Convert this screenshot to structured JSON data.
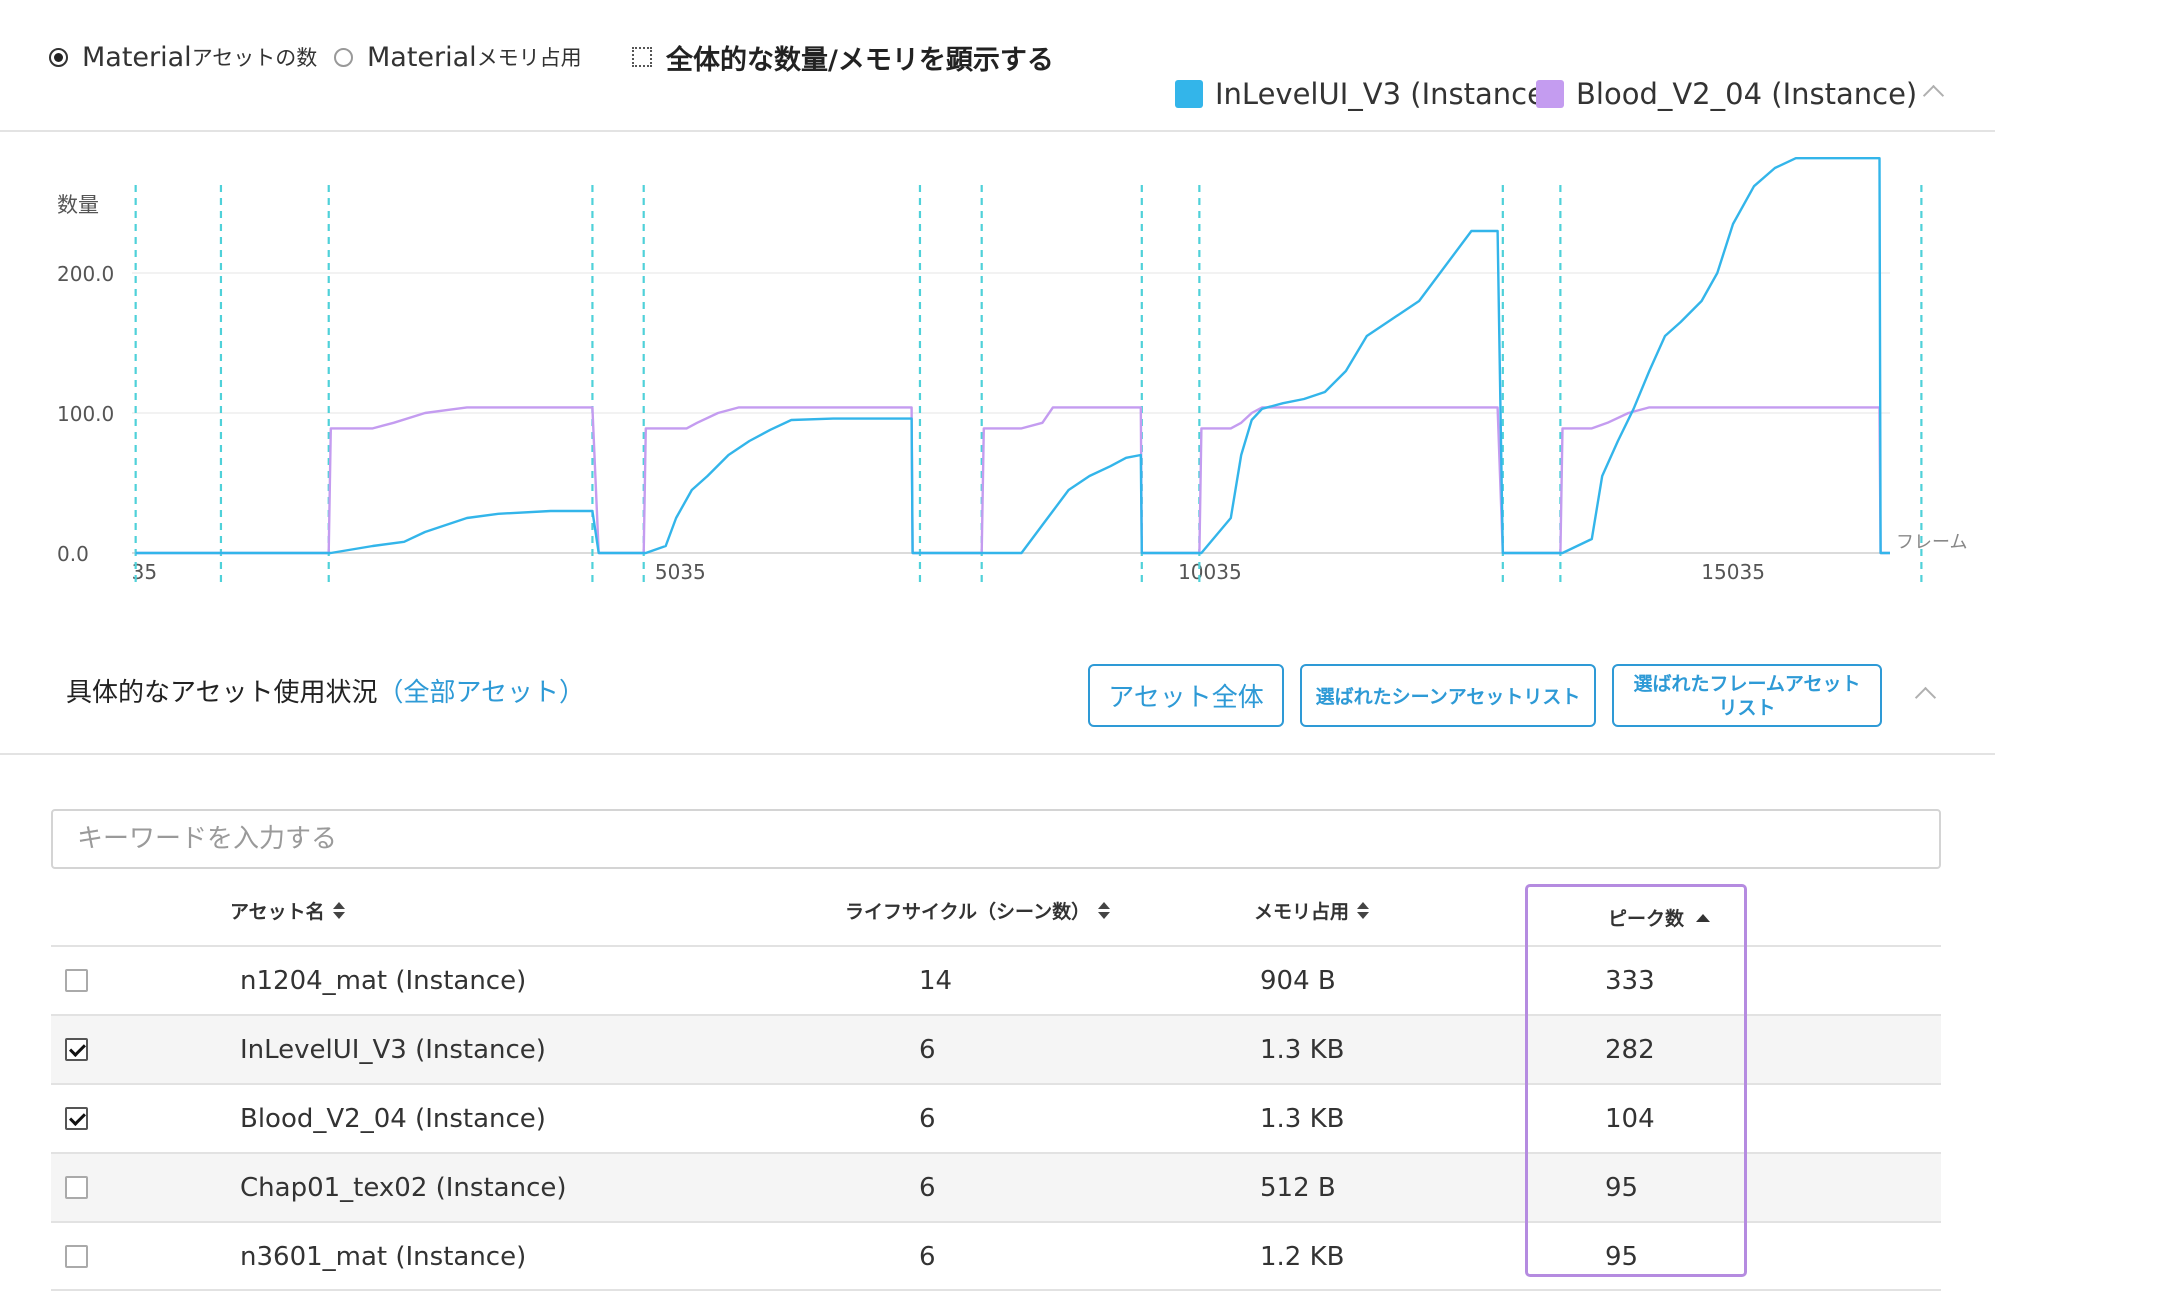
{
  "options": {
    "radio_count_main": "Material",
    "radio_count_sub": "アセットの数",
    "radio_memory_main": "Material",
    "radio_memory_sub": "メモリ占用",
    "show_total_label": "全体的な数量/メモリを顕示する",
    "selected": "count"
  },
  "legend": [
    {
      "label": "InLevelUI_V3 (Instance)",
      "color": "#33b5ea"
    },
    {
      "label": "Blood_V2_04 (Instance)",
      "color": "#c49cf0"
    }
  ],
  "icons": {
    "collapse": "chevron-up-icon",
    "sort": "sort-icon",
    "check": "checkbox-icon"
  },
  "chart_data": {
    "type": "line",
    "ylabel": "数量",
    "xlabel": "フレーム",
    "x_tick_labels": [
      "35",
      "5035",
      "10035",
      "15035"
    ],
    "y_tick_labels": [
      "0.0",
      "100.0",
      "200.0"
    ],
    "x_ticks": [
      35,
      5035,
      10035,
      15035
    ],
    "y_ticks": [
      0,
      100,
      200
    ],
    "xlim": [
      0,
      16800
    ],
    "ylim": [
      0,
      280
    ],
    "grid": "horizontal",
    "scene_markers": [
      35,
      850,
      1880,
      4400,
      4890,
      7530,
      8120,
      9650,
      10200,
      13100,
      13650,
      17100
    ],
    "series": [
      {
        "name": "InLevelUI_V3 (Instance)",
        "color": "#33b5ea",
        "x": [
          35,
          1880,
          1900,
          2300,
          2600,
          2800,
          3000,
          3200,
          3500,
          4000,
          4400,
          4460,
          4890,
          4910,
          5100,
          5200,
          5350,
          5500,
          5700,
          5900,
          6100,
          6300,
          6700,
          7000,
          7450,
          7460,
          7530,
          8120,
          8140,
          8500,
          8700,
          8800,
          8950,
          9150,
          9350,
          9500,
          9640,
          9650,
          10200,
          10220,
          10500,
          10600,
          10700,
          10800,
          11000,
          11200,
          11400,
          11600,
          11800,
          12000,
          12300,
          12800,
          13000,
          13050,
          13100,
          13650,
          13670,
          13950,
          14050,
          14200,
          14350,
          14500,
          14650,
          14800,
          15000,
          15150,
          15300,
          15500,
          15700,
          15900,
          16300,
          16700,
          16710,
          16800
        ],
        "y": [
          0,
          0,
          0,
          5,
          8,
          15,
          20,
          25,
          28,
          30,
          30,
          0,
          0,
          0,
          5,
          25,
          45,
          55,
          70,
          80,
          88,
          95,
          96,
          96,
          96,
          0,
          0,
          0,
          0,
          0,
          20,
          30,
          45,
          55,
          62,
          68,
          70,
          0,
          0,
          0,
          25,
          70,
          95,
          103,
          107,
          110,
          115,
          130,
          155,
          165,
          180,
          230,
          230,
          230,
          0,
          0,
          0,
          10,
          55,
          80,
          103,
          130,
          155,
          165,
          180,
          200,
          235,
          262,
          275,
          282,
          282,
          282,
          0,
          0
        ]
      },
      {
        "name": "Blood_V2_04 (Instance)",
        "color": "#c49cf0",
        "x": [
          35,
          1880,
          1900,
          2300,
          2500,
          2800,
          3000,
          3200,
          4400,
          4460,
          4890,
          4910,
          5300,
          5400,
          5600,
          5800,
          7450,
          7460,
          7530,
          8120,
          8140,
          8500,
          8700,
          8800,
          9640,
          9650,
          10200,
          10220,
          10500,
          10600,
          10700,
          10800,
          13050,
          13100,
          13650,
          13670,
          13950,
          14100,
          14300,
          14500,
          16700,
          16710,
          16800
        ],
        "y": [
          0,
          0,
          89,
          89,
          93,
          100,
          102,
          104,
          104,
          0,
          0,
          89,
          89,
          93,
          100,
          104,
          104,
          0,
          0,
          0,
          89,
          89,
          93,
          104,
          104,
          0,
          0,
          89,
          89,
          93,
          100,
          104,
          104,
          0,
          0,
          89,
          89,
          93,
          100,
          104,
          104,
          0,
          0
        ]
      }
    ]
  },
  "section": {
    "title": "具体的なアセット使用状況",
    "link": "（全部アセット）",
    "btn_all": "アセット全体",
    "btn_scene_list": "選ばれたシーンアセットリスト",
    "btn_frame_list_line1": "選ばれたフレームアセット",
    "btn_frame_list_line2": "リスト"
  },
  "search": {
    "placeholder": "キーワードを入力する",
    "value": ""
  },
  "table": {
    "headers": {
      "name": "アセット名",
      "lifecycle": "ライフサイクル（シーン数）",
      "memory": "メモリ占用",
      "peak": "ピーク数"
    },
    "rows": [
      {
        "checked": false,
        "name": "n1204_mat (Instance)",
        "lifecycle": "14",
        "memory": "904 B",
        "peak": "333"
      },
      {
        "checked": true,
        "name": "InLevelUI_V3 (Instance)",
        "lifecycle": "6",
        "memory": "1.3 KB",
        "peak": "282"
      },
      {
        "checked": true,
        "name": "Blood_V2_04 (Instance)",
        "lifecycle": "6",
        "memory": "1.3 KB",
        "peak": "104"
      },
      {
        "checked": false,
        "name": "Chap01_tex02 (Instance)",
        "lifecycle": "6",
        "memory": "512 B",
        "peak": "95"
      },
      {
        "checked": false,
        "name": "n3601_mat (Instance)",
        "lifecycle": "6",
        "memory": "1.2 KB",
        "peak": "95"
      }
    ]
  }
}
